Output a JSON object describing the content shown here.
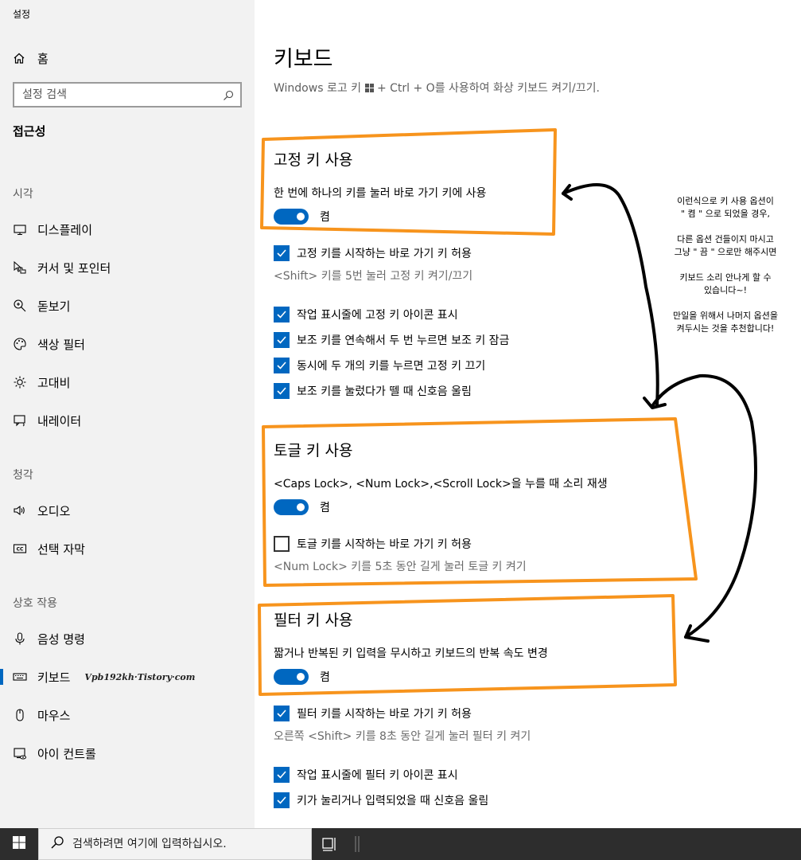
{
  "window": {
    "title": "설정"
  },
  "sidebar": {
    "home_label": "홈",
    "search_placeholder": "설정 검색",
    "category_title": "접근성",
    "groups": [
      {
        "title": "시각",
        "items": [
          {
            "label": "디스플레이",
            "icon": "display-icon"
          },
          {
            "label": "커서 및 포인터",
            "icon": "cursor-pointer-icon"
          },
          {
            "label": "돋보기",
            "icon": "magnifier-icon"
          },
          {
            "label": "색상 필터",
            "icon": "palette-icon"
          },
          {
            "label": "고대비",
            "icon": "brightness-icon"
          },
          {
            "label": "내레이터",
            "icon": "narrator-icon"
          }
        ]
      },
      {
        "title": "청각",
        "items": [
          {
            "label": "오디오",
            "icon": "speaker-icon"
          },
          {
            "label": "선택 자막",
            "icon": "closed-caption-icon"
          }
        ]
      },
      {
        "title": "상호 작용",
        "items": [
          {
            "label": "음성 명령",
            "icon": "microphone-icon"
          },
          {
            "label": "키보드",
            "icon": "keyboard-icon",
            "selected": true
          },
          {
            "label": "마우스",
            "icon": "mouse-icon"
          },
          {
            "label": "아이 컨트롤",
            "icon": "eye-control-icon"
          }
        ]
      }
    ],
    "watermark": "Vpb192kh·Tistory·com"
  },
  "main": {
    "title": "키보드",
    "description_before": "Windows 로고 키 ",
    "description_after": " + Ctrl + O를 사용하여 화상 키보드 켜기/끄기.",
    "sticky": {
      "title": "고정 키 사용",
      "description": "한 번에 하나의 키를 눌러 바로 가기 키에 사용",
      "toggle_label": "켬",
      "shortcut_label": "고정 키를 시작하는 바로 가기 키 허용",
      "shortcut_hint": "<Shift> 키를 5번 눌러 고정 키 켜기/끄기",
      "options": [
        "작업 표시줄에 고정 키 아이콘 표시",
        "보조 키를 연속해서 두 번 누르면 보조 키 잠금",
        "동시에 두 개의 키를 누르면 고정 키 끄기",
        "보조 키를 눌렀다가 뗄 때 신호음 울림"
      ]
    },
    "toggle_keys": {
      "title": "토글 키 사용",
      "description": "<Caps Lock>, <Num Lock>,<Scroll Lock>을 누를 때 소리 재생",
      "toggle_label": "켬",
      "shortcut_label": "토글 키를 시작하는 바로 가기 키 허용",
      "shortcut_hint": "<Num Lock> 키를 5초 동안 길게 눌러 토글 키 켜기"
    },
    "filter": {
      "title": "필터 키 사용",
      "description": "짧거나 반복된 키 입력을 무시하고 키보드의 반복 속도 변경",
      "toggle_label": "켬",
      "shortcut_label": "필터 키를 시작하는 바로 가기 키 허용",
      "shortcut_hint": "오른쪽 <Shift> 키를 8초 동안 길게 눌러 필터 키 켜기",
      "options": [
        "작업 표시줄에 필터 키 아이콘 표시",
        "키가 눌리거나 입력되었을 때 신호음 울림"
      ]
    }
  },
  "annotation": {
    "paragraphs": [
      "이런식으로 키 사용 옵션이\n\" 켬 \" 으로 되었을 경우,",
      "다른 옵션 건들이지 마시고\n그냥 \" 끔 \" 으로만 해주시면",
      "키보드 소리 안나게 할 수\n있습니다~!",
      "만일을 위해서 나머지 옵션을\n켜두시는 것을 추천합니다!"
    ],
    "box_color": "#f7941d"
  },
  "taskbar": {
    "search_placeholder": "검색하려면 여기에 입력하십시오."
  },
  "colors": {
    "accent": "#0067c0",
    "sidebar_bg": "#f2f2f2",
    "taskbar_bg": "#2d2d2d"
  }
}
